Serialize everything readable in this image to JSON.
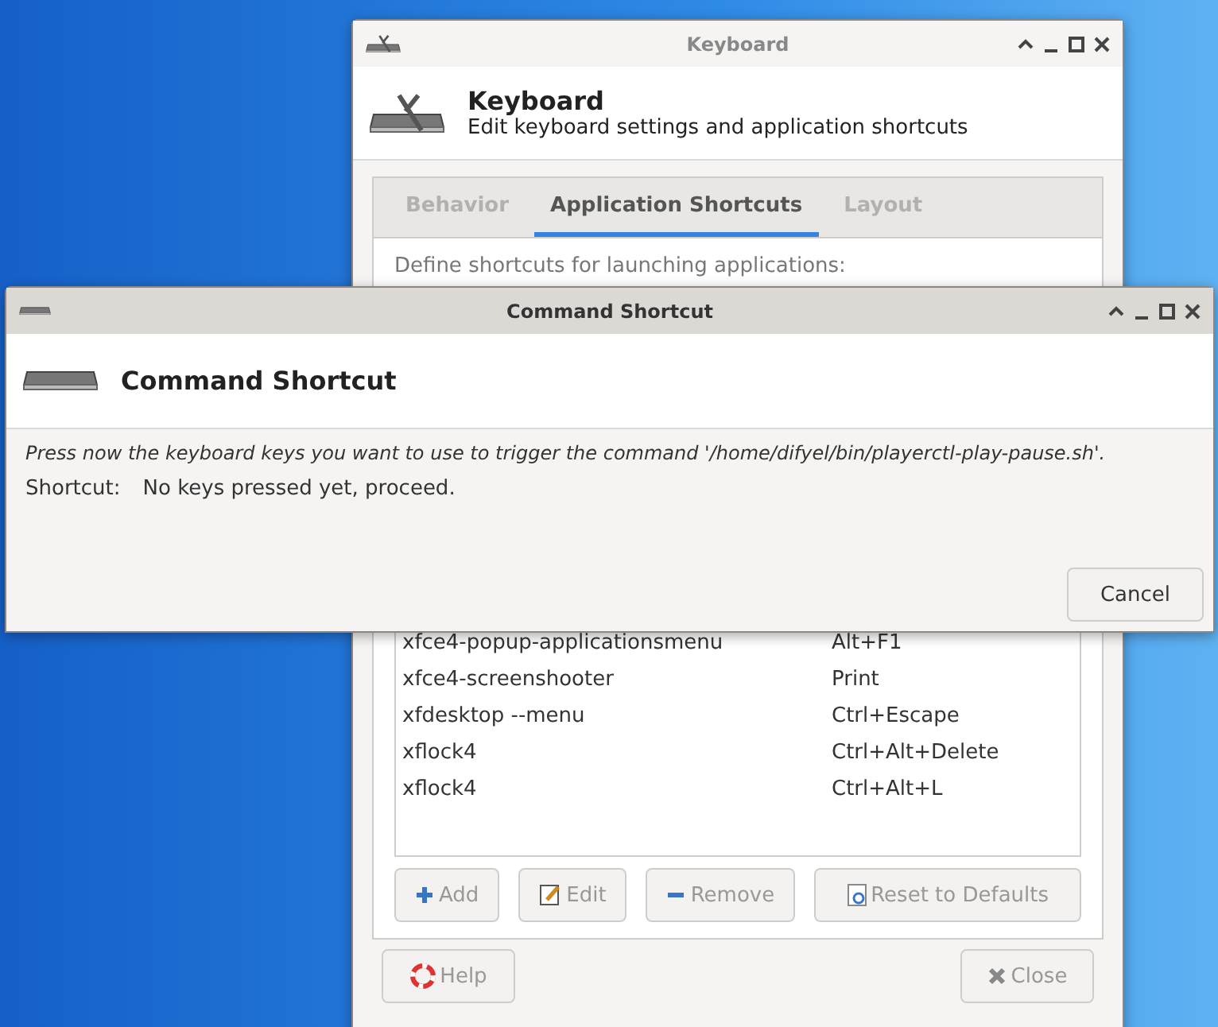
{
  "keyboard_window": {
    "title": "Keyboard",
    "header": {
      "title": "Keyboard",
      "subtitle": "Edit keyboard settings and application shortcuts"
    },
    "tabs": [
      {
        "label": "Behavior",
        "selected": false
      },
      {
        "label": "Application Shortcuts",
        "selected": true
      },
      {
        "label": "Layout",
        "selected": false
      }
    ],
    "description": "Define shortcuts for launching applications:",
    "shortcuts": [
      {
        "command": "xfce4-popup-applicationsmenu",
        "shortcut": "Alt+F1"
      },
      {
        "command": "xfce4-screenshooter",
        "shortcut": "Print"
      },
      {
        "command": "xfdesktop --menu",
        "shortcut": "Ctrl+Escape"
      },
      {
        "command": "xflock4",
        "shortcut": "Ctrl+Alt+Delete"
      },
      {
        "command": "xflock4",
        "shortcut": "Ctrl+Alt+L"
      }
    ],
    "list_buttons": [
      {
        "kind": "add",
        "label": "Add",
        "disabled": true
      },
      {
        "kind": "edit",
        "label": "Edit",
        "disabled": true
      },
      {
        "kind": "remove",
        "label": "Remove",
        "disabled": true
      },
      {
        "kind": "reset",
        "label": "Reset to Defaults",
        "disabled": true
      }
    ],
    "footer_buttons": [
      {
        "kind": "help",
        "label": "Help",
        "disabled": true
      },
      {
        "kind": "close",
        "label": "Close",
        "disabled": true
      }
    ]
  },
  "dialog": {
    "title": "Command Shortcut",
    "header": "Command Shortcut",
    "message": "Press now the keyboard keys you want to use to trigger the command '/home/difyel/bin/playerctl-play-pause.sh'.",
    "shortcut_label": "Shortcut:",
    "shortcut_value": "No keys pressed yet, proceed.",
    "buttons": [
      {
        "label": "Cancel"
      }
    ]
  }
}
